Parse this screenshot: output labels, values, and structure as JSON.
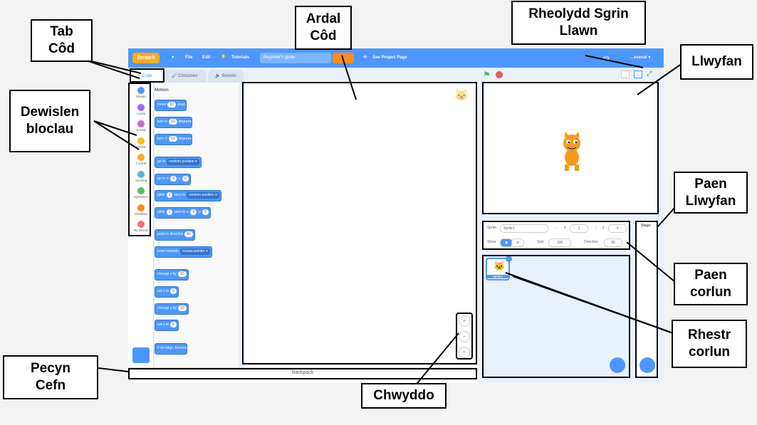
{
  "menubar": {
    "logo": "Scratch",
    "globe": "🌐 ▾",
    "file": "File",
    "edit": "Edit",
    "tutorials": "Tutorials",
    "project_title": "Beginner's guide",
    "see_project_page": "See Project Page",
    "user": "...ssecat ▾"
  },
  "tabs": {
    "code": "Code",
    "costumes": "Costumes",
    "sounds": "Sounds"
  },
  "categories": [
    {
      "label": "Motion",
      "color": "#4c97ff"
    },
    {
      "label": "Looks",
      "color": "#9966ff"
    },
    {
      "label": "Sound",
      "color": "#cf63cf"
    },
    {
      "label": "Events",
      "color": "#ffbf00"
    },
    {
      "label": "Control",
      "color": "#ffab19"
    },
    {
      "label": "Sensing",
      "color": "#5cb1d6"
    },
    {
      "label": "Operators",
      "color": "#59c059"
    },
    {
      "label": "Variables",
      "color": "#ff8c1a"
    },
    {
      "label": "My Blocks",
      "color": "#ff6680"
    }
  ],
  "palette": {
    "heading": "Motion",
    "move": "move",
    "move_val": "10",
    "steps": "steps",
    "turn": "turn",
    "turn_cw": "↻",
    "turn_ccw": "↺",
    "turn_val": "15",
    "degrees": "degrees",
    "goto": "go to",
    "random_position": "random position ▾",
    "goto_xy": "go to x:",
    "x_val": "0",
    "y_label": "y:",
    "y_val": "0",
    "glide": "glide",
    "glide_val": "1",
    "secs_to": "secs to",
    "secs_to_x": "secs to x:",
    "point_dir": "point in direction",
    "dir_val": "90",
    "point_towards": "point towards",
    "mouse_pointer": "mouse-pointer ▾",
    "change_x": "change x by",
    "change_val": "10",
    "set_x": "set x to",
    "change_y": "change y by",
    "set_y": "set y to",
    "bounce": "if on edge, bounce"
  },
  "zoom": {
    "in": "+",
    "out": "−",
    "reset": "="
  },
  "backpack": "Backpack",
  "sprite_info": {
    "sprite_label": "Sprite",
    "sprite_name": "Sprite1",
    "x_label": "x",
    "x_val": "0",
    "y_label": "y",
    "y_val": "0",
    "show_label": "Show",
    "size_label": "Size",
    "size_val": "100",
    "direction_label": "Direction",
    "direction_val": "90"
  },
  "sprite_list": {
    "sprite_name": "Sprite1"
  },
  "stage_pane": {
    "title": "Stage"
  },
  "callouts": {
    "tab_code": "Tab\nCôd",
    "code_area": "Ardal\nCôd",
    "fullscreen": "Rheolydd Sgrin\nLlawn",
    "stage": "Llwyfan",
    "blocks_menu": "Dewislen\nbloclau",
    "stage_pane": "Paen\nLlwyfan",
    "sprite_pane": "Paen\ncorlun",
    "sprite_list": "Rhestr\ncorlun",
    "backpack": "Pecyn\nCefn",
    "zoom": "Chwyddo"
  }
}
